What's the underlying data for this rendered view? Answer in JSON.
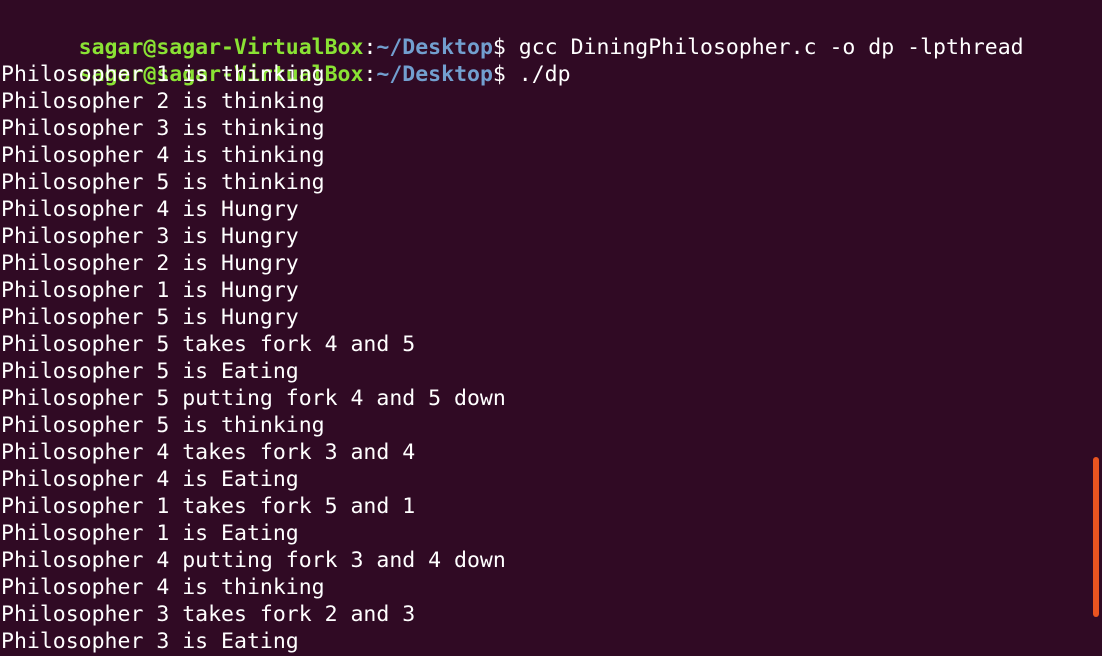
{
  "terminal": {
    "prompt": {
      "user_host": "sagar@sagar-VirtualBox",
      "separator": ":",
      "path": "~/Desktop",
      "symbol": "$ "
    },
    "commands": [
      "gcc DiningPhilosopher.c -o dp -lpthread",
      "./dp"
    ],
    "output": [
      "Philosopher 1 is thinking",
      "Philosopher 2 is thinking",
      "Philosopher 3 is thinking",
      "Philosopher 4 is thinking",
      "Philosopher 5 is thinking",
      "Philosopher 4 is Hungry",
      "Philosopher 3 is Hungry",
      "Philosopher 2 is Hungry",
      "Philosopher 1 is Hungry",
      "Philosopher 5 is Hungry",
      "Philosopher 5 takes fork 4 and 5",
      "Philosopher 5 is Eating",
      "Philosopher 5 putting fork 4 and 5 down",
      "Philosopher 5 is thinking",
      "Philosopher 4 takes fork 3 and 4",
      "Philosopher 4 is Eating",
      "Philosopher 1 takes fork 5 and 1",
      "Philosopher 1 is Eating",
      "Philosopher 4 putting fork 3 and 4 down",
      "Philosopher 4 is thinking",
      "Philosopher 3 takes fork 2 and 3",
      "Philosopher 3 is Eating"
    ]
  },
  "colors": {
    "background": "#300a24",
    "user_host": "#8ae234",
    "path": "#729fcf",
    "text": "#ffffff",
    "scrollbar": "#e95420"
  }
}
